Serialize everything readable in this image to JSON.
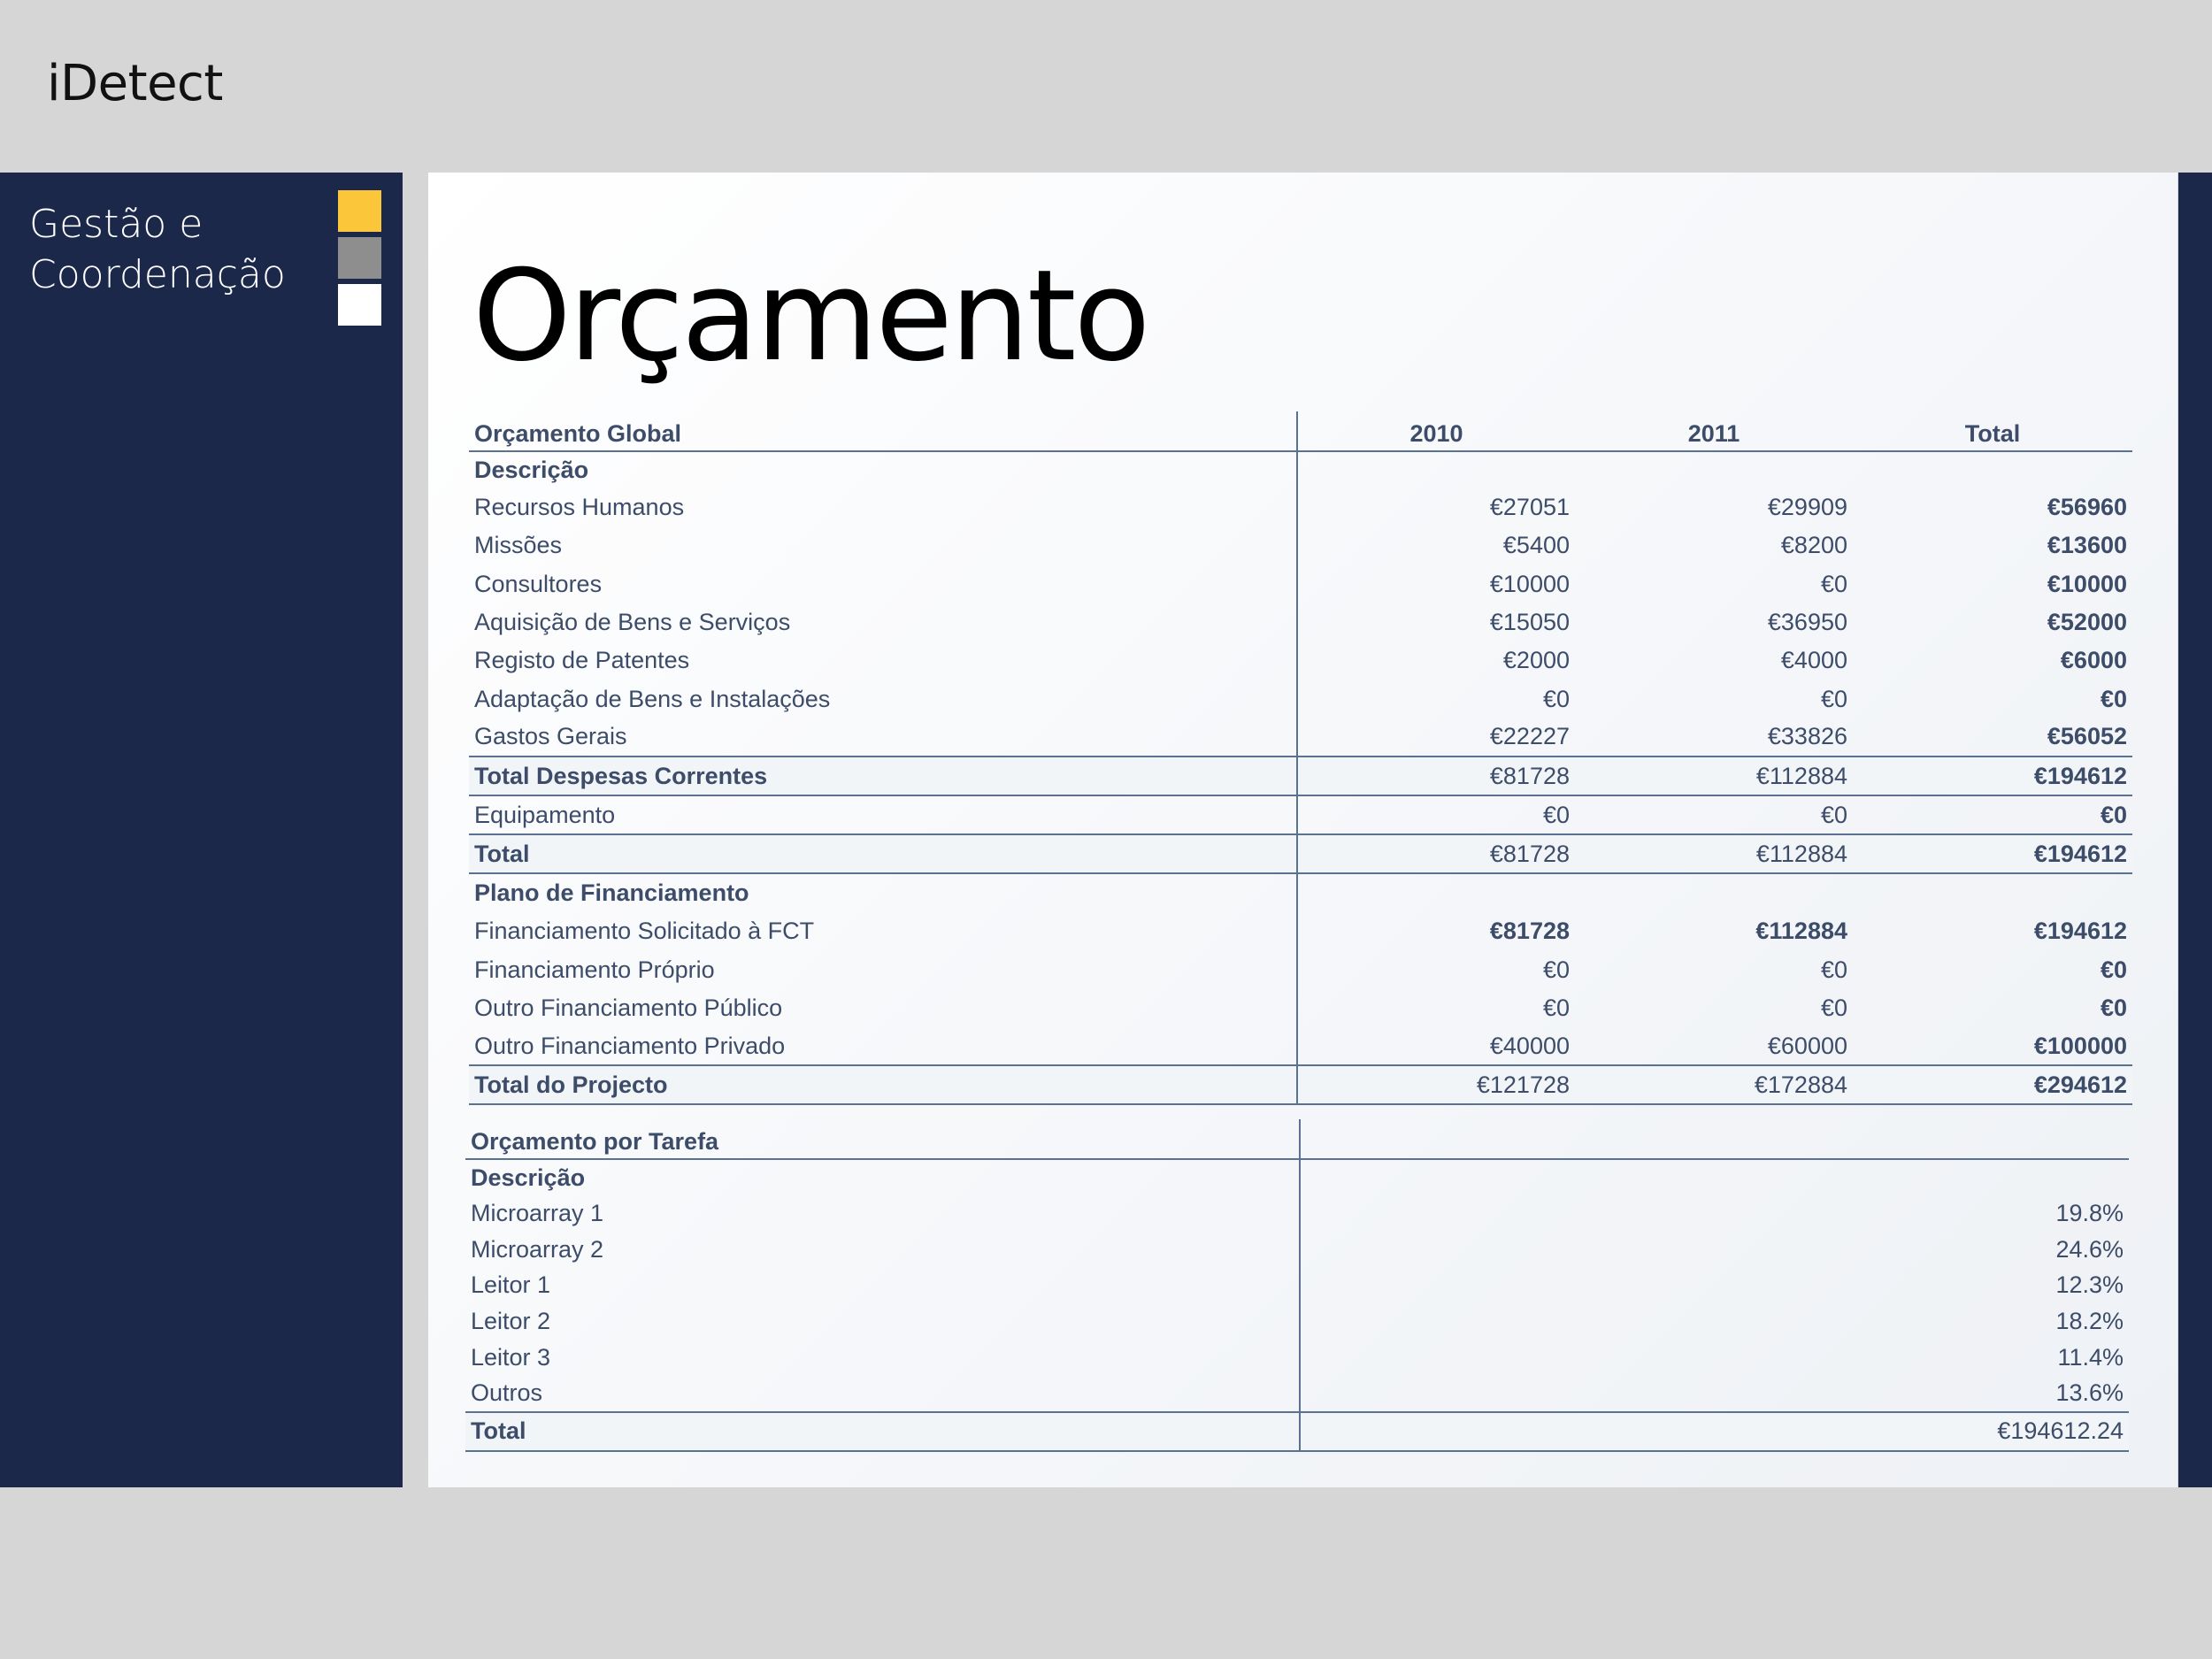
{
  "app": {
    "title": "iDetect"
  },
  "sidebar": {
    "title": "Gestão e Coordenação",
    "swatches": [
      "#fbc63a",
      "#8e8e8e",
      "#ffffff"
    ]
  },
  "page": {
    "title": "Orçamento"
  },
  "global_budget": {
    "header": [
      "Orçamento Global",
      "2010",
      "2011",
      "Total"
    ],
    "desc_label": "Descrição",
    "items": [
      [
        "Recursos Humanos",
        "€27051",
        "€29909",
        "€56960"
      ],
      [
        "Missões",
        "€5400",
        "€8200",
        "€13600"
      ],
      [
        "Consultores",
        "€10000",
        "€0",
        "€10000"
      ],
      [
        "Aquisição de Bens e Serviços",
        "€15050",
        "€36950",
        "€52000"
      ],
      [
        "Registo de Patentes",
        "€2000",
        "€4000",
        "€6000"
      ],
      [
        "Adaptação de Bens e Instalações",
        "€0",
        "€0",
        "€0"
      ],
      [
        "Gastos Gerais",
        "€22227",
        "€33826",
        "€56052"
      ]
    ],
    "total_correntes": [
      "Total Despesas Correntes",
      "€81728",
      "€112884",
      "€194612"
    ],
    "equipamento": [
      "Equipamento",
      "€0",
      "€0",
      "€0"
    ],
    "total": [
      "Total",
      "€81728",
      "€112884",
      "€194612"
    ],
    "financing_label": "Plano de Financiamento",
    "financing": [
      [
        "Financiamento Solicitado à FCT",
        "€81728",
        "€112884",
        "€194612"
      ],
      [
        "Financiamento Próprio",
        "€0",
        "€0",
        "€0"
      ],
      [
        "Outro Financiamento Público",
        "€0",
        "€0",
        "€0"
      ],
      [
        "Outro Financiamento Privado",
        "€40000",
        "€60000",
        "€100000"
      ]
    ],
    "total_projecto": [
      "Total do Projecto",
      "€121728",
      "€172884",
      "€294612"
    ]
  },
  "task_budget": {
    "header": "Orçamento por Tarefa",
    "desc_label": "Descrição",
    "items": [
      [
        "Microarray 1",
        "19.8%"
      ],
      [
        "Microarray 2",
        "24.6%"
      ],
      [
        "Leitor 1",
        "12.3%"
      ],
      [
        "Leitor 2",
        "18.2%"
      ],
      [
        "Leitor 3",
        "11.4%"
      ],
      [
        "Outros",
        "13.6%"
      ]
    ],
    "total": [
      "Total",
      "€194612.24"
    ]
  }
}
